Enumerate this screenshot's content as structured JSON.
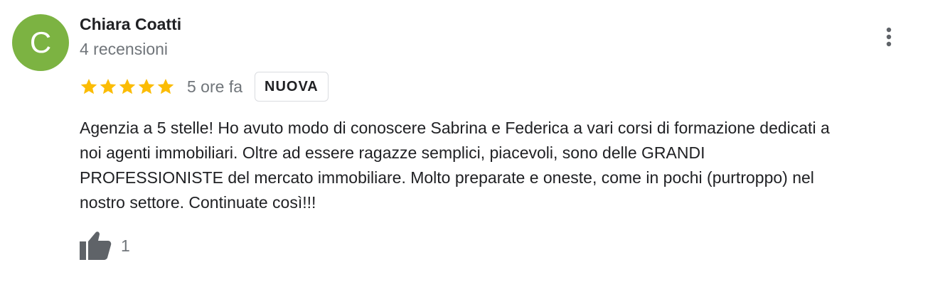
{
  "colors": {
    "avatar_bg": "#7cb342",
    "star": "#fbbc04",
    "muted_text": "#70757a",
    "icon": "#5f6368"
  },
  "review": {
    "author": {
      "initial": "C",
      "name": "Chiara Coatti",
      "review_count": "4 recensioni"
    },
    "rating": 5,
    "rating_max": 5,
    "time_ago": "5 ore fa",
    "badge": "NUOVA",
    "text_lines": [
      "Agenzia a 5 stelle! Ho avuto modo di conoscere Sabrina e Federica a vari corsi di formazione dedicati a",
      "noi agenti immobiliari. Oltre ad essere ragazze semplici, piacevoli, sono delle GRANDI",
      "PROFESSIONISTE del mercato immobiliare. Molto preparate e oneste, come in pochi (purtroppo) nel",
      "nostro settore. Continuate così!!!"
    ],
    "likes": "1"
  },
  "icons": {
    "more": "more-vert-icon",
    "star": "star-icon",
    "like": "thumb-up-icon"
  }
}
